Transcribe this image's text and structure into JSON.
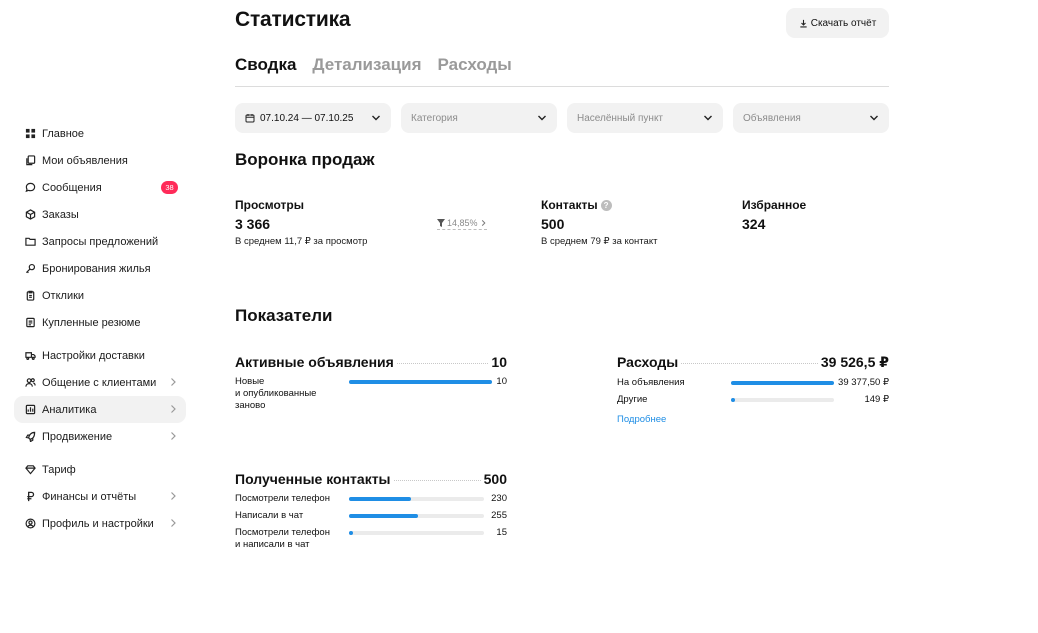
{
  "sidebar": {
    "items": [
      {
        "label": "Главное",
        "icon": "grid-icon"
      },
      {
        "label": "Мои объявления",
        "icon": "copy-icon"
      },
      {
        "label": "Сообщения",
        "icon": "chat-icon",
        "badge": "38"
      },
      {
        "label": "Заказы",
        "icon": "box-icon"
      },
      {
        "label": "Запросы предложений",
        "icon": "folder-icon"
      },
      {
        "label": "Бронирования жилья",
        "icon": "key-icon"
      },
      {
        "label": "Отклики",
        "icon": "clipboard-icon"
      },
      {
        "label": "Купленные резюме",
        "icon": "document-icon"
      },
      {
        "label": "Настройки доставки",
        "icon": "truck-icon"
      },
      {
        "label": "Общение с клиентами",
        "icon": "people-icon"
      },
      {
        "label": "Аналитика",
        "icon": "analytics-icon"
      },
      {
        "label": "Продвижение",
        "icon": "rocket-icon"
      },
      {
        "label": "Тариф",
        "icon": "diamond-icon"
      },
      {
        "label": "Финансы и отчёты",
        "icon": "ruble-icon"
      },
      {
        "label": "Профиль и настройки",
        "icon": "profile-icon"
      }
    ]
  },
  "header": {
    "title": "Статистика",
    "download_label": "Скачать отчёт"
  },
  "tabs": [
    "Сводка",
    "Детализация",
    "Расходы"
  ],
  "filters": {
    "date": "07.10.24 — 07.10.25",
    "category": "Категория",
    "city": "Населённый пункт",
    "ads": "Объявления"
  },
  "funnel": {
    "title": "Воронка продаж",
    "views": {
      "label": "Просмотры",
      "value": "3 366",
      "sub": "В среднем 11,7 ₽ за просмотр"
    },
    "conversion": "14,85%",
    "contacts": {
      "label": "Контакты",
      "value": "500",
      "sub": "В среднем 79 ₽ за контакт",
      "help": "?"
    },
    "favorites": {
      "label": "Избранное",
      "value": "324"
    }
  },
  "indicators": {
    "title": "Показатели",
    "active_ads": {
      "title": "Активные объявления",
      "total": "10",
      "rows": [
        {
          "label": "Новые\nи опубликованные\nзаново",
          "value": "10",
          "fraction": 1.0
        }
      ]
    },
    "expenses": {
      "title": "Расходы",
      "total": "39 526,5 ₽",
      "rows": [
        {
          "label": "На объявления",
          "value": "39 377,50 ₽",
          "fraction": 0.996
        },
        {
          "label": "Другие",
          "value": "149 ₽",
          "fraction": 0.04
        }
      ],
      "more_label": "Подробнее"
    },
    "contacts": {
      "title": "Полученные контакты",
      "total": "500",
      "rows": [
        {
          "label": "Посмотрели телефон",
          "value": "230",
          "fraction": 0.46
        },
        {
          "label": "Написали в чат",
          "value": "255",
          "fraction": 0.51
        },
        {
          "label": "Посмотрели телефон\nи написали в чат",
          "value": "15",
          "fraction": 0.03
        }
      ]
    }
  },
  "colors": {
    "accent": "#1f8ee5",
    "badge": "#ff2b59",
    "surface": "#f2f2f2"
  }
}
